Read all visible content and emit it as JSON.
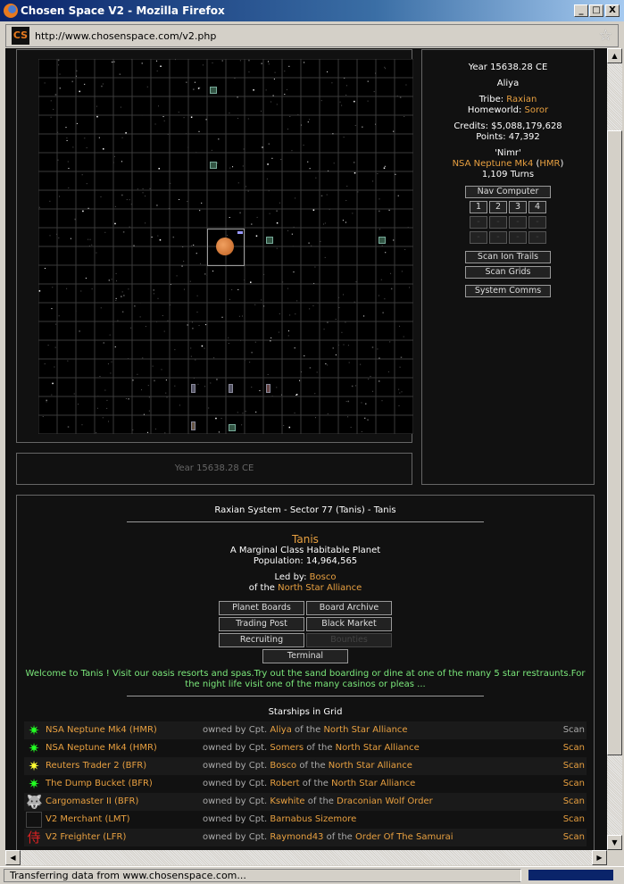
{
  "window": {
    "title": "Chosen Space V2 - Mozilla Firefox",
    "min": "_",
    "max": "□",
    "close": "X"
  },
  "address": {
    "url": "http://www.chosenspace.com/v2.php",
    "favicon": "CS"
  },
  "map": {
    "year_label": "Year 15638.28 CE"
  },
  "player": {
    "year": "Year 15638.28 CE",
    "name": "Aliya",
    "tribe_label": "Tribe:",
    "tribe": "Raxian",
    "homeworld_label": "Homeworld:",
    "homeworld": "Soror",
    "credits": "Credits: $5,088,179,628",
    "points": "Points: 47,392",
    "ship_name": "'Nimr'",
    "ship_model": "NSA Neptune Mk4",
    "ship_class": "HMR",
    "turns": "1,109 Turns"
  },
  "nav": {
    "nav_computer": "Nav Computer",
    "slots": [
      "1",
      "2",
      "3",
      "4"
    ],
    "empty": "-",
    "scan_ion": "Scan Ion Trails",
    "scan_grids": "Scan Grids",
    "system_comms": "System Comms"
  },
  "location": {
    "breadcrumb": "Raxian System - Sector 77 (Tanis) - Tanis",
    "planet": "Tanis",
    "planet_class": "A Marginal Class Habitable Planet",
    "population": "Population: 14,964,565",
    "led_by_label": "Led by:",
    "leader": "Bosco",
    "of_the": "of the",
    "alliance": "North Star Alliance",
    "buttons": {
      "boards": "Planet Boards",
      "archive": "Board Archive",
      "trading": "Trading Post",
      "black_market": "Black Market",
      "recruiting": "Recruiting",
      "bounties": "Bounties",
      "terminal": "Terminal"
    },
    "welcome": "Welcome to Tanis ! Visit our oasis resorts and spas.Try out the sand boarding or dine at one of the many 5 star restraunts.For the night life visit one of the many casinos or pleas ..."
  },
  "starships": {
    "title": "Starships in Grid",
    "owned_by": "owned by Cpt.",
    "of_the": "of the",
    "scan": "Scan",
    "rows": [
      {
        "icon": "green-star",
        "ship": "NSA Neptune Mk4 (HMR)",
        "captain": "Aliya",
        "faction": "North Star Alliance",
        "scan_active": false
      },
      {
        "icon": "green-star",
        "ship": "NSA Neptune Mk4 (HMR)",
        "captain": "Somers",
        "faction": "North Star Alliance",
        "scan_active": true
      },
      {
        "icon": "yellow-star",
        "ship": "Reuters Trader 2 (BFR)",
        "captain": "Bosco",
        "faction": "North Star Alliance",
        "scan_active": true
      },
      {
        "icon": "green-star",
        "ship": "The Dump Bucket (BFR)",
        "captain": "Robert",
        "faction": "North Star Alliance",
        "scan_active": true
      },
      {
        "icon": "wolf",
        "ship": "Cargomaster II (BFR)",
        "captain": "Kswhite",
        "faction": "Draconian Wolf Order",
        "scan_active": true
      },
      {
        "icon": "empty",
        "ship": "V2 Merchant (LMT)",
        "captain": "Barnabus Sizemore",
        "faction": "",
        "scan_active": true
      },
      {
        "icon": "samurai",
        "ship": "V2 Freighter (LFR)",
        "captain": "Raymond43",
        "faction": "Order Of The Samurai",
        "scan_active": true
      }
    ]
  },
  "status": {
    "text": "Transferring data from www.chosenspace.com..."
  },
  "colors": {
    "accent": "#e8a040",
    "welcome": "#7be87b",
    "background": "#111111"
  }
}
